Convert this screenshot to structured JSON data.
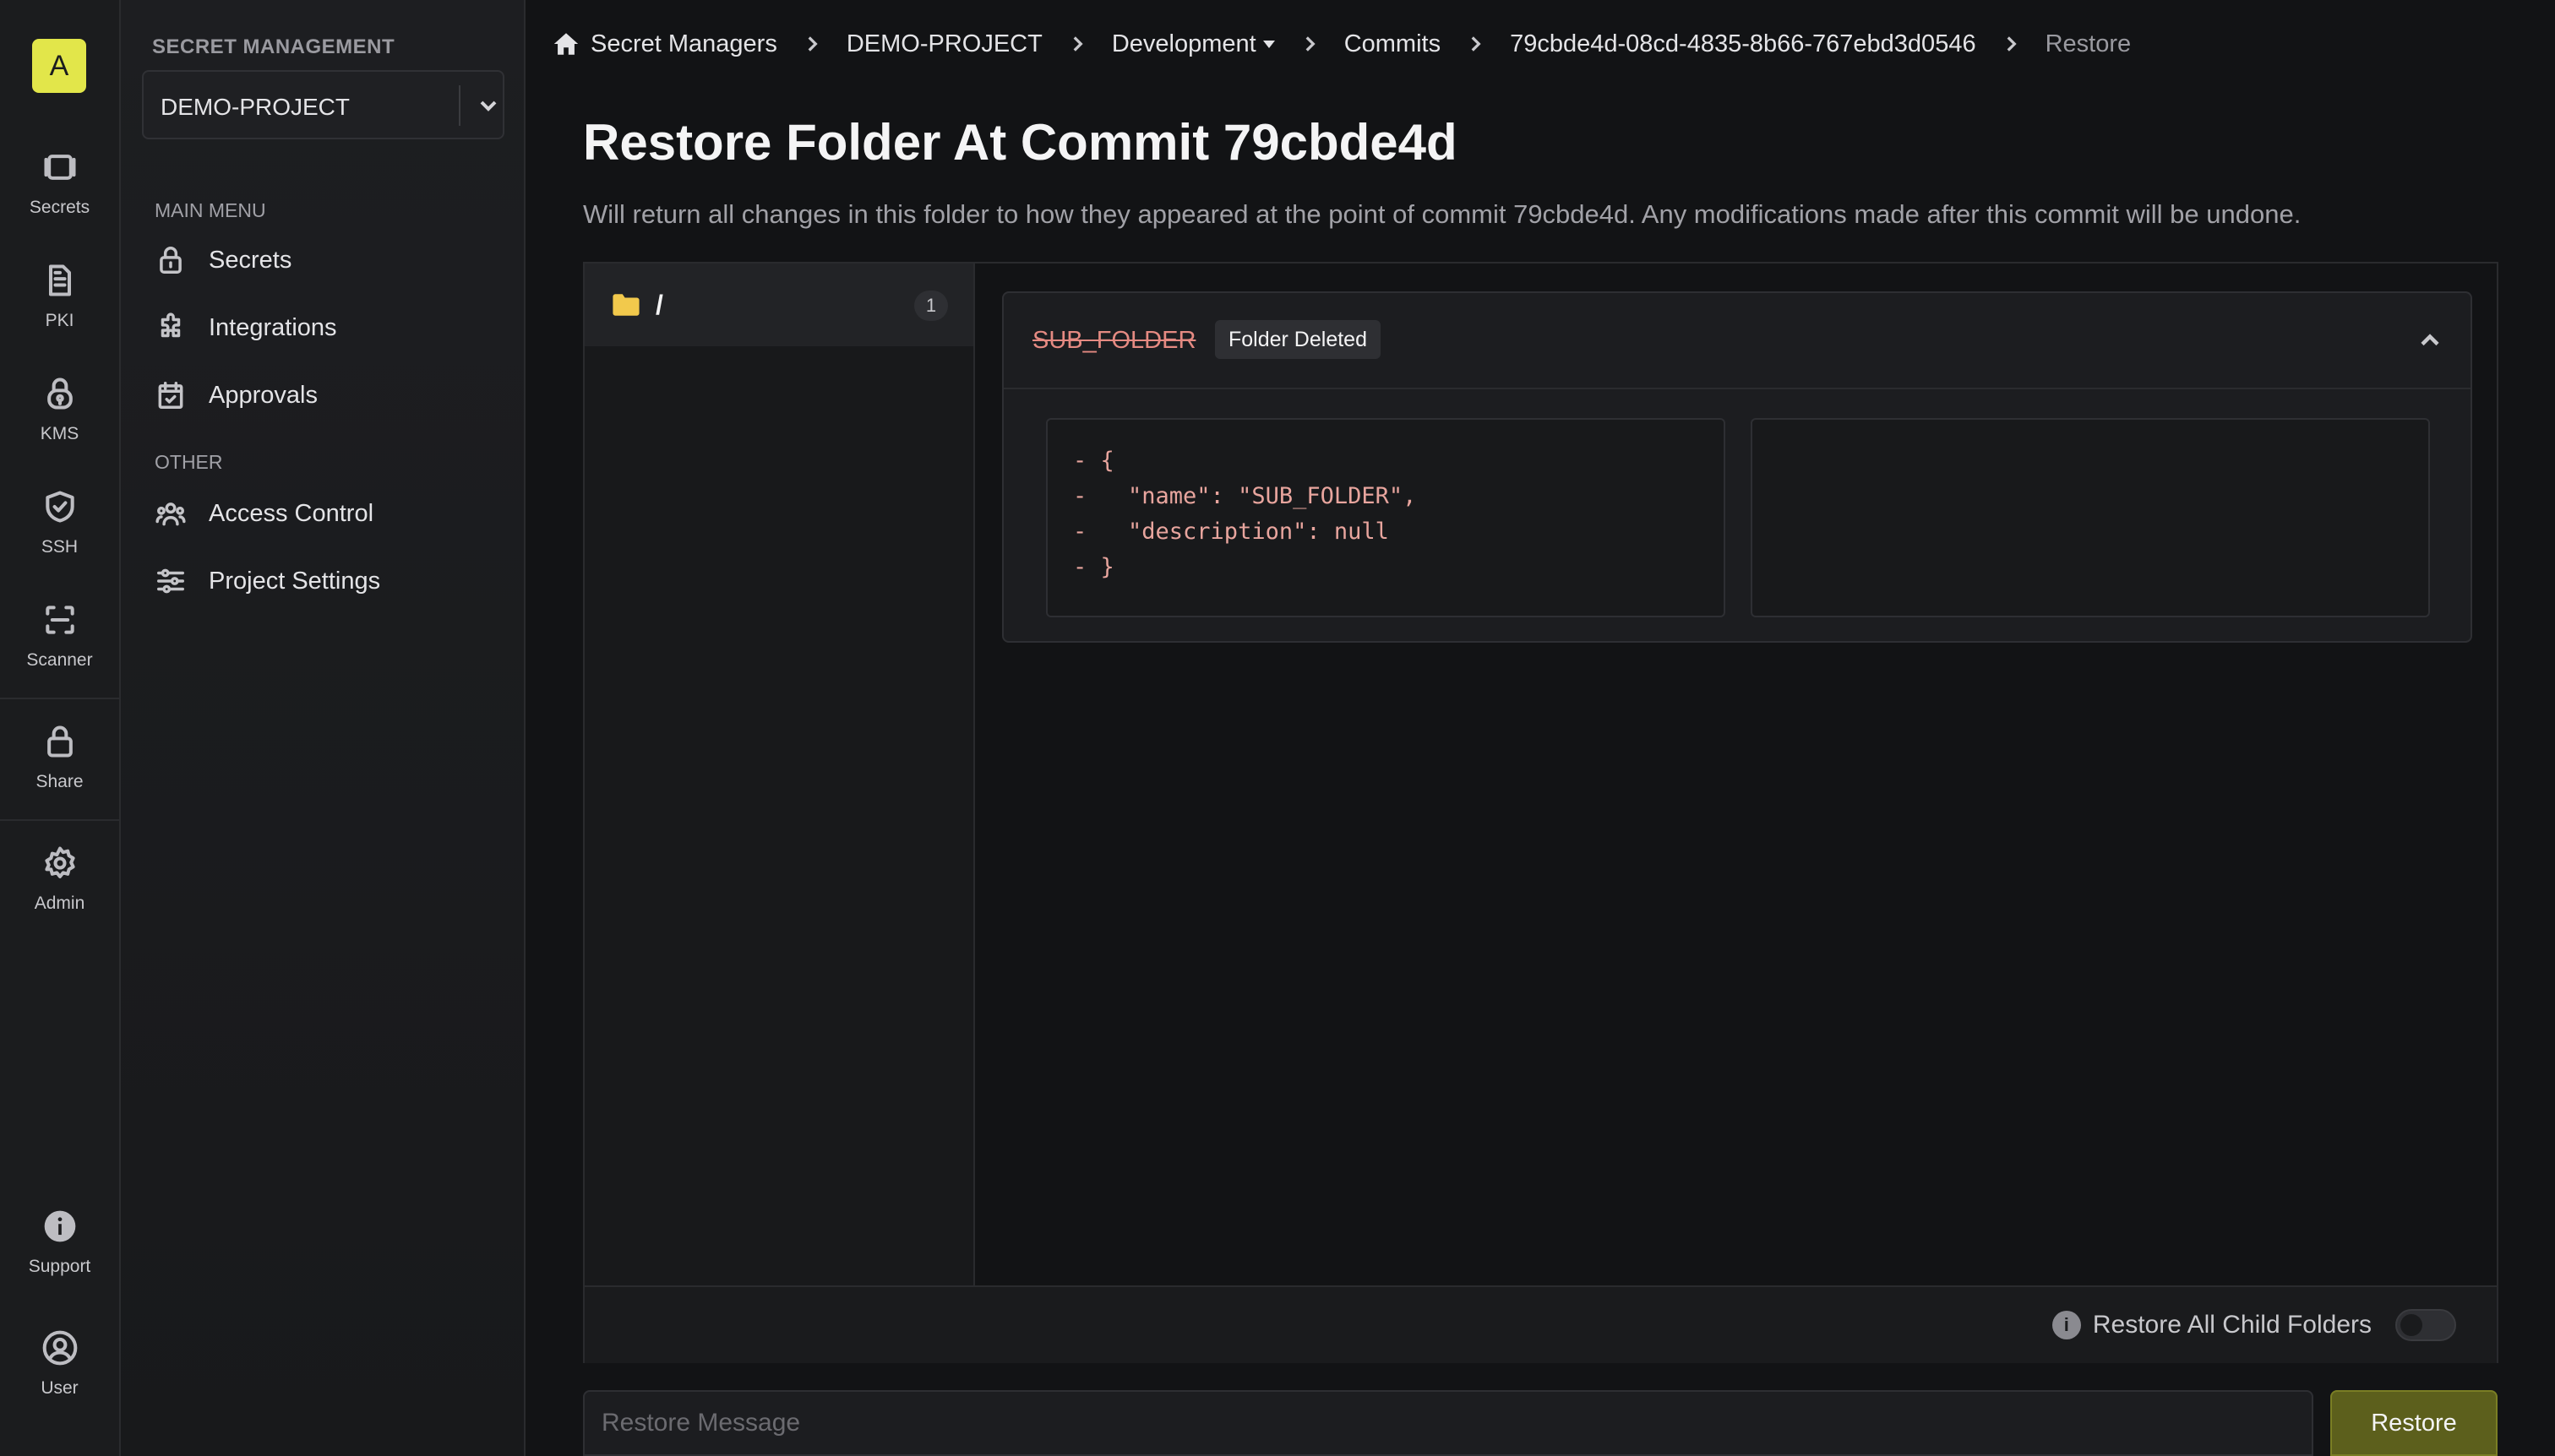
{
  "rail": {
    "avatar": "A",
    "items": [
      {
        "label": "Secrets",
        "icon": "vault-icon"
      },
      {
        "label": "PKI",
        "icon": "document-icon"
      },
      {
        "label": "KMS",
        "icon": "key-lock-icon"
      },
      {
        "label": "SSH",
        "icon": "shield-check-icon"
      },
      {
        "label": "Scanner",
        "icon": "scan-icon"
      },
      {
        "label": "Share",
        "icon": "lock-icon"
      },
      {
        "label": "Admin",
        "icon": "gear-icon"
      },
      {
        "label": "Support",
        "icon": "info-circle-icon"
      },
      {
        "label": "User",
        "icon": "user-circle-icon"
      }
    ]
  },
  "sidebar": {
    "section_title": "SECRET MANAGEMENT",
    "project": "DEMO-PROJECT",
    "main_menu_label": "MAIN MENU",
    "main_items": [
      {
        "label": "Secrets",
        "icon": "lock-icon"
      },
      {
        "label": "Integrations",
        "icon": "puzzle-icon"
      },
      {
        "label": "Approvals",
        "icon": "calendar-check-icon"
      }
    ],
    "other_label": "OTHER",
    "other_items": [
      {
        "label": "Access Control",
        "icon": "users-icon"
      },
      {
        "label": "Project Settings",
        "icon": "sliders-icon"
      }
    ]
  },
  "breadcrumb": {
    "home": "Secret Managers",
    "project": "DEMO-PROJECT",
    "environment": "Development",
    "commits": "Commits",
    "commit_id": "79cbde4d-08cd-4835-8b66-767ebd3d0546",
    "current": "Restore"
  },
  "header": {
    "title": "Restore Folder At Commit 79cbde4d",
    "description": "Will return all changes in this folder to how they appeared at the point of commit 79cbde4d. Any modifications made after this commit will be undone."
  },
  "tree": {
    "path": "/",
    "count": "1"
  },
  "change": {
    "name": "SUB_FOLDER",
    "badge": "Folder Deleted",
    "old_lines": [
      "- {",
      "-   \"name\": \"SUB_FOLDER\",",
      "-   \"description\": null",
      "- }"
    ]
  },
  "footer": {
    "toggle_label": "Restore All Child Folders",
    "message_placeholder": "Restore Message",
    "restore_button": "Restore"
  },
  "colors": {
    "accent": "#e2e64a",
    "deleted": "#e58a82",
    "restore_button": "#5c5f1c"
  }
}
